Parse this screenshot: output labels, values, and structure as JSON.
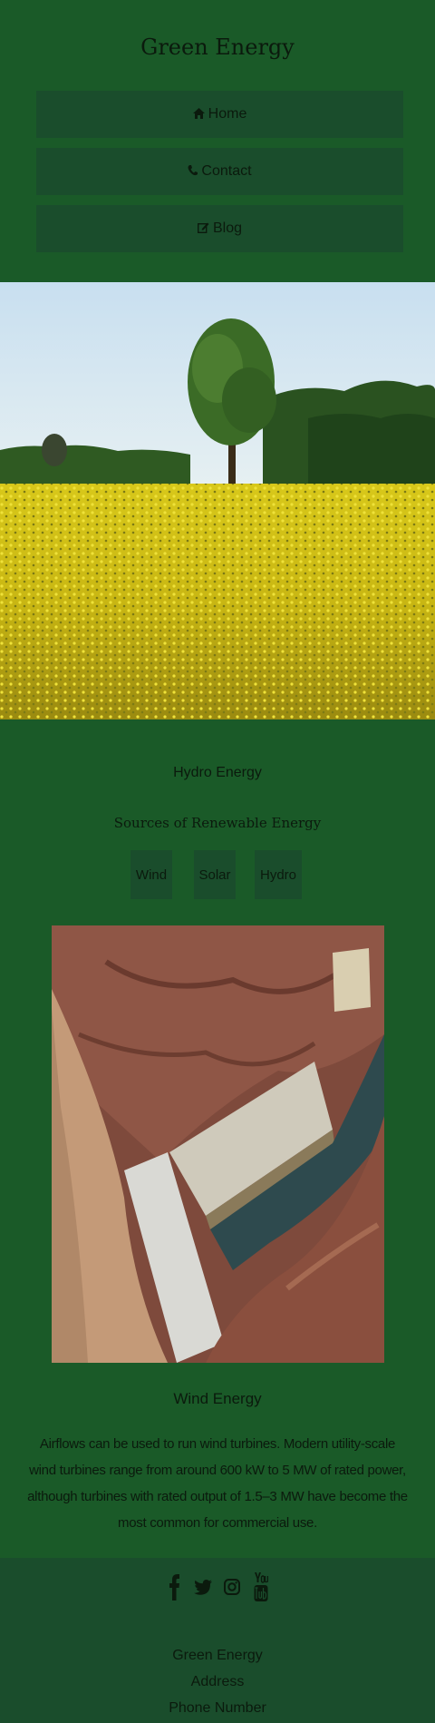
{
  "header": {
    "title": "Green Energy",
    "nav": [
      {
        "label": "Home",
        "icon": "home-icon"
      },
      {
        "label": "Contact",
        "icon": "phone-icon"
      },
      {
        "label": "Blog",
        "icon": "edit-icon"
      }
    ]
  },
  "main": {
    "section_title": "Hydro Energy",
    "sources_title": "Sources of Renewable Energy",
    "sources": [
      "Wind",
      "Solar",
      "Hydro"
    ],
    "wind_title": "Wind Energy",
    "wind_text": "Airflows can be used to run wind turbines. Modern utility-scale wind turbines range from around 600 kW to 5 MW of rated power, although turbines with rated output of 1.5–3 MW have become the most common for commercial use."
  },
  "footer": {
    "socials": [
      "facebook-icon",
      "twitter-icon",
      "instagram-icon",
      "youtube-icon"
    ],
    "lines": [
      "Green Energy",
      "Address",
      "Phone Number"
    ]
  },
  "colors": {
    "background": "#1a5a28",
    "panel": "#1a4d2c",
    "text": "#0b1a0d"
  }
}
